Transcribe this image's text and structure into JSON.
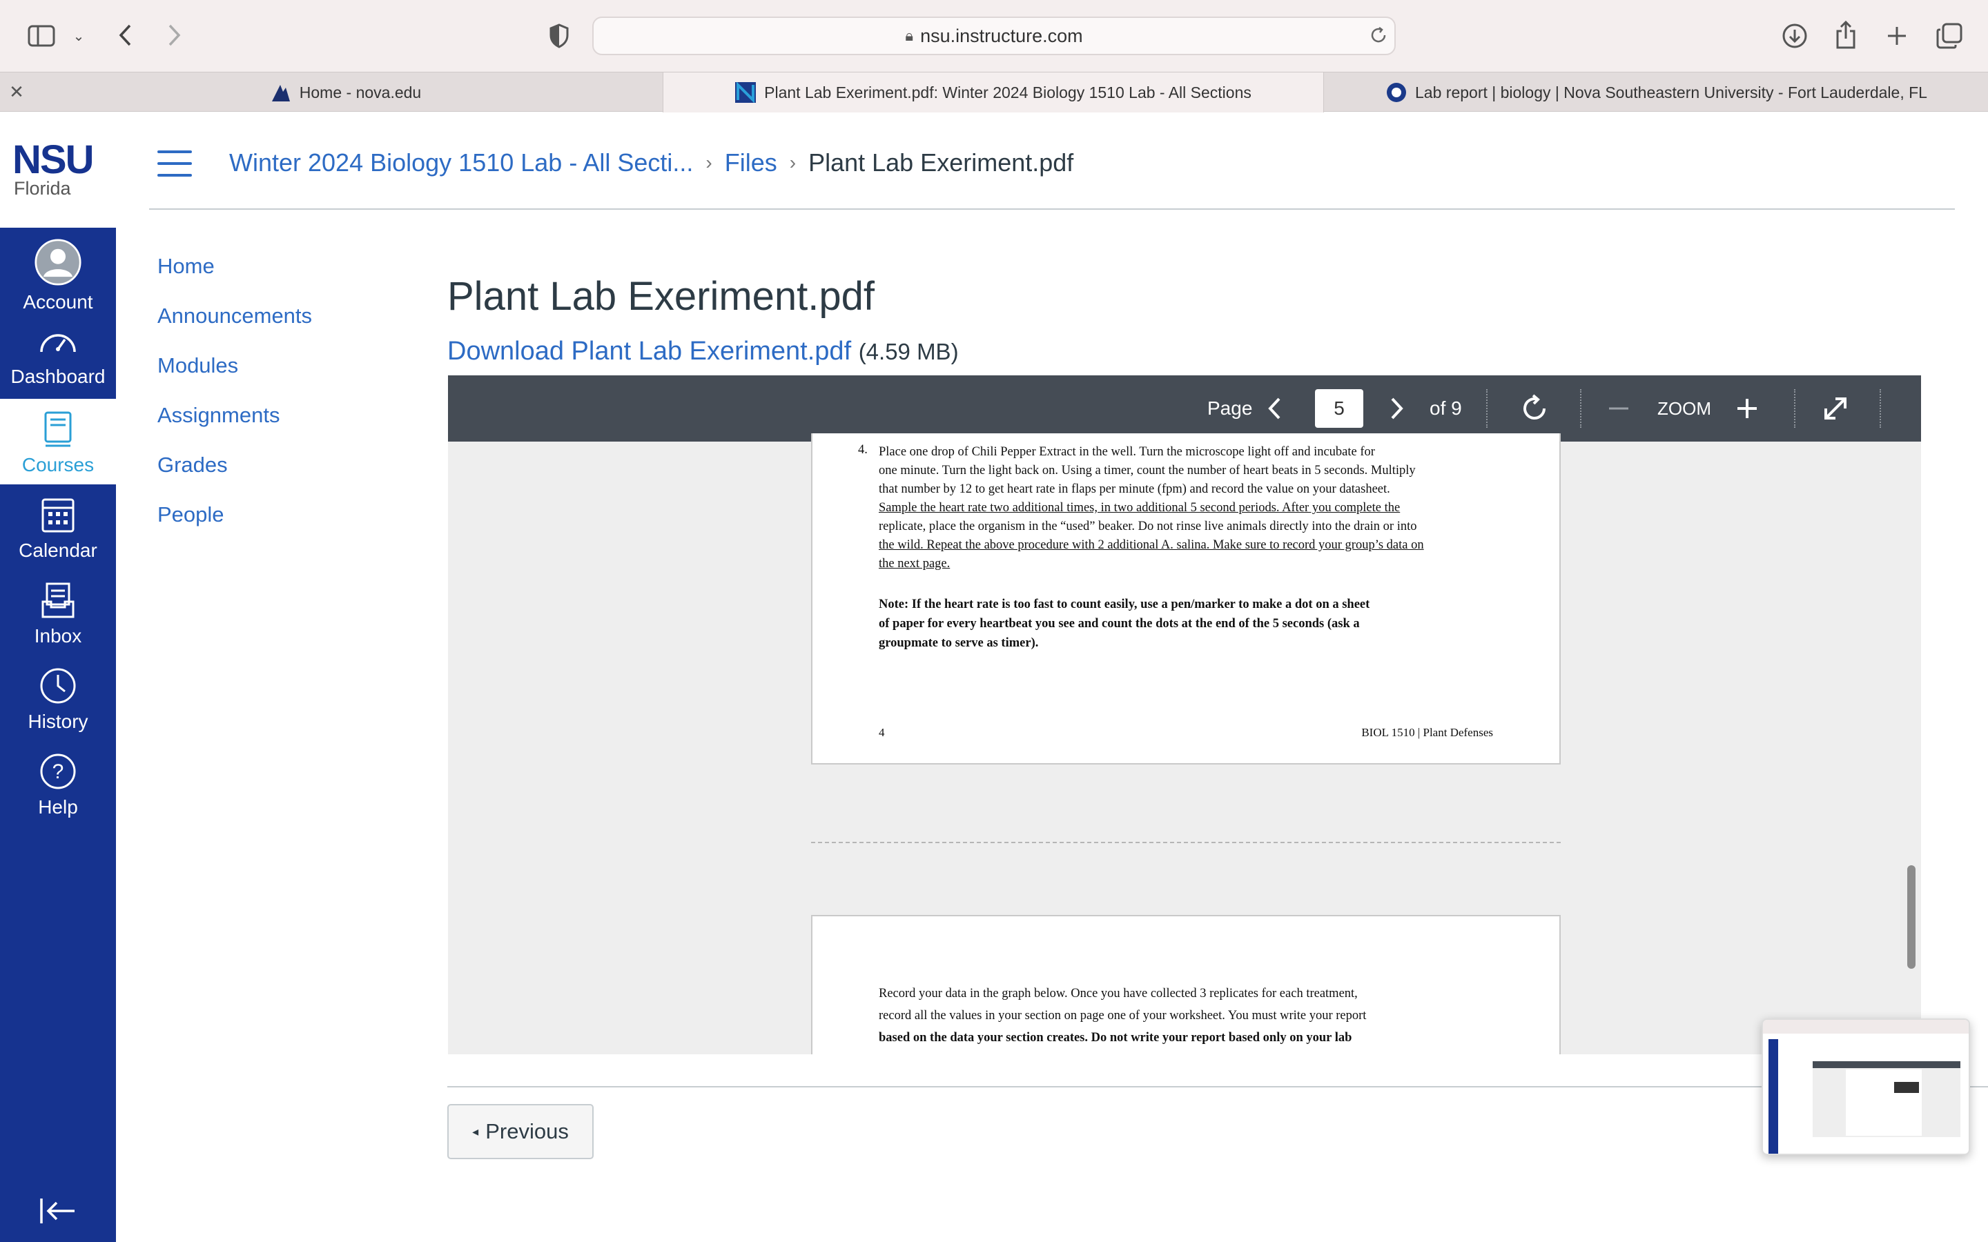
{
  "browser": {
    "url": "nsu.instructure.com",
    "tabs": [
      {
        "title": "Home - nova.edu",
        "active": false
      },
      {
        "title": "Plant Lab Exeriment.pdf: Winter 2024 Biology 1510 Lab - All Sections",
        "active": true
      },
      {
        "title": "Lab report | biology | Nova Southeastern University - Fort Lauderdale, FL",
        "active": false
      }
    ]
  },
  "logo": {
    "name": "NSU",
    "sub": "Florida"
  },
  "global_nav": [
    {
      "label": "Account",
      "icon": "avatar-icon"
    },
    {
      "label": "Dashboard",
      "icon": "dashboard-icon"
    },
    {
      "label": "Courses",
      "icon": "courses-icon",
      "active": true
    },
    {
      "label": "Calendar",
      "icon": "calendar-icon"
    },
    {
      "label": "Inbox",
      "icon": "inbox-icon"
    },
    {
      "label": "History",
      "icon": "history-icon"
    },
    {
      "label": "Help",
      "icon": "help-icon"
    }
  ],
  "breadcrumb": {
    "course": "Winter 2024 Biology 1510 Lab - All Secti...",
    "files": "Files",
    "current": "Plant Lab Exeriment.pdf"
  },
  "course_nav": [
    "Home",
    "Announcements",
    "Modules",
    "Assignments",
    "Grades",
    "People"
  ],
  "page": {
    "title": "Plant Lab Exeriment.pdf",
    "download_label": "Download Plant Lab Exeriment.pdf",
    "download_size": "(4.59 MB)"
  },
  "viewer": {
    "page_label": "Page",
    "page_value": "5",
    "page_total": "of 9",
    "zoom_label": "ZOOM"
  },
  "pdf": {
    "step_number": "4.",
    "step_lines": [
      "Place one drop of Chili Pepper Extract in the well. Turn the microscope light off and incubate for",
      "one minute. Turn the light back on.  Using a timer, count the number of heart beats in 5 seconds. Multiply",
      "that number by 12 to get heart rate in flaps per minute (fpm) and record the value on your datasheet.",
      "Sample the heart rate two additional times, in two additional 5 second periods. After you complete the",
      "replicate, place the organism in the “used” beaker. Do not rinse live animals directly into the drain or into",
      "the wild. Repeat the above procedure with 2 additional A. salina. Make sure to record your group’s data on",
      "the next page."
    ],
    "note_lines": [
      "Note: If the heart rate is too fast to count easily, use a pen/marker to make a dot on a sheet",
      "of paper for every heartbeat you see and count the dots at the end of the 5 seconds (ask a",
      "groupmate to serve as timer)."
    ],
    "footer_page": "4",
    "footer_title": "BIOL 1510 | Plant Defenses",
    "next_lines": [
      "Record your data in the graph below. Once you have collected 3 replicates for each treatment,",
      "record all the values in your section on page one of your worksheet. You must write your report",
      "based on the data your section creates. Do not write your report based only on your lab"
    ]
  },
  "footer": {
    "previous_label": "Previous"
  },
  "colors": {
    "nav_bg": "#16338f",
    "link": "#2d6bc4",
    "viewer_toolbar": "#454c55"
  }
}
